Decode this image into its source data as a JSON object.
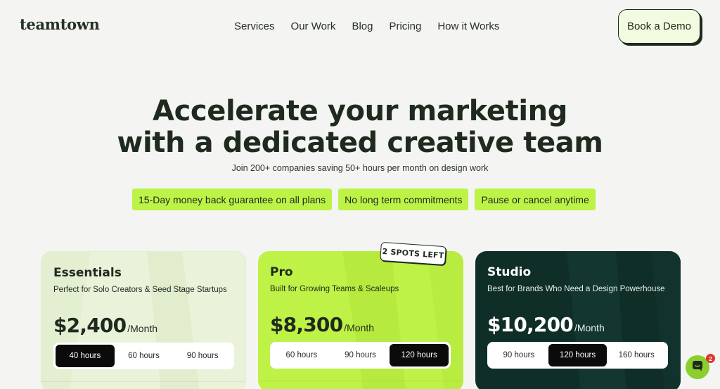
{
  "nav": {
    "logo": "teamtown",
    "links": [
      "Services",
      "Our Work",
      "Blog",
      "Pricing",
      "How it Works"
    ],
    "cta": "Book a Demo"
  },
  "hero": {
    "title_line1": "Accelerate your marketing",
    "title_line2": "with a dedicated creative team",
    "subtitle": "Join 200+ companies saving 50+ hours per month on design work",
    "pills": [
      "15-Day money back guarantee on all plans",
      "No long term commitments",
      "Pause or cancel anytime"
    ]
  },
  "plans": [
    {
      "name": "Essentials",
      "desc": "Perfect for Solo Creators & Seed Stage Startups",
      "price": "$2,400",
      "per": "/Month",
      "hours": [
        "40 hours",
        "60 hours",
        "90 hours"
      ],
      "selected_hours": "40 hours"
    },
    {
      "name": "Pro",
      "desc": "Built for Growing Teams & Scaleups",
      "price": "$8,300",
      "per": "/Month",
      "hours": [
        "60 hours",
        "90 hours",
        "120 hours"
      ],
      "selected_hours": "120 hours",
      "badge": "2 SPOTS LEFT"
    },
    {
      "name": "Studio",
      "desc": "Best for Brands Who Need a Design Powerhouse",
      "price": "$10,200",
      "per": "/Month",
      "hours": [
        "90 hours",
        "120 hours",
        "160 hours"
      ],
      "selected_hours": "120 hours"
    }
  ],
  "chat": {
    "icon": "chat-bubble-icon",
    "badge_count": "2"
  },
  "colors": {
    "accent": "#bdf347",
    "dark_card": "#0f2e28",
    "light_card": "#eaf3da",
    "pro_card": "#bff246",
    "text": "#1f2a1f"
  }
}
